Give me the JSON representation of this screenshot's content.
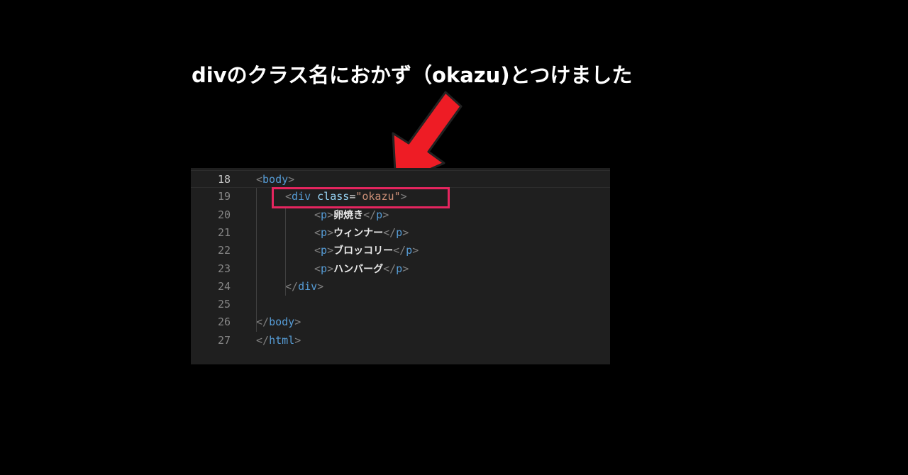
{
  "caption": "divのクラス名におかず（okazu)とつけました",
  "editor": {
    "lines": [
      {
        "num": "18",
        "parts": [
          [
            "br",
            "<"
          ],
          [
            "tag",
            "body"
          ],
          [
            "br",
            ">"
          ]
        ],
        "indent": 0
      },
      {
        "num": "19",
        "parts": [
          [
            "br",
            "<"
          ],
          [
            "tag",
            "div"
          ],
          [
            "txt0",
            " "
          ],
          [
            "attr",
            "class"
          ],
          [
            "txt0",
            "="
          ],
          [
            "str",
            "\"okazu\""
          ],
          [
            "br",
            ">"
          ]
        ],
        "indent": 1
      },
      {
        "num": "20",
        "parts": [
          [
            "br",
            "<"
          ],
          [
            "tag",
            "p"
          ],
          [
            "br",
            ">"
          ],
          [
            "txt",
            "卵焼き"
          ],
          [
            "br",
            "</"
          ],
          [
            "tag",
            "p"
          ],
          [
            "br",
            ">"
          ]
        ],
        "indent": 2
      },
      {
        "num": "21",
        "parts": [
          [
            "br",
            "<"
          ],
          [
            "tag",
            "p"
          ],
          [
            "br",
            ">"
          ],
          [
            "txt",
            "ウィンナー"
          ],
          [
            "br",
            "</"
          ],
          [
            "tag",
            "p"
          ],
          [
            "br",
            ">"
          ]
        ],
        "indent": 2
      },
      {
        "num": "22",
        "parts": [
          [
            "br",
            "<"
          ],
          [
            "tag",
            "p"
          ],
          [
            "br",
            ">"
          ],
          [
            "txt",
            "ブロッコリー"
          ],
          [
            "br",
            "</"
          ],
          [
            "tag",
            "p"
          ],
          [
            "br",
            ">"
          ]
        ],
        "indent": 2
      },
      {
        "num": "23",
        "parts": [
          [
            "br",
            "<"
          ],
          [
            "tag",
            "p"
          ],
          [
            "br",
            ">"
          ],
          [
            "txt",
            "ハンバーグ"
          ],
          [
            "br",
            "</"
          ],
          [
            "tag",
            "p"
          ],
          [
            "br",
            ">"
          ]
        ],
        "indent": 2
      },
      {
        "num": "24",
        "parts": [
          [
            "br",
            "</"
          ],
          [
            "tag",
            "div"
          ],
          [
            "br",
            ">"
          ]
        ],
        "indent": 1
      },
      {
        "num": "25",
        "parts": [],
        "indent": 0
      },
      {
        "num": "26",
        "parts": [
          [
            "br",
            "</"
          ],
          [
            "tag",
            "body"
          ],
          [
            "br",
            ">"
          ]
        ],
        "indent": 0
      },
      {
        "num": "27",
        "parts": [
          [
            "br",
            "</"
          ],
          [
            "tag",
            "html"
          ],
          [
            "br",
            ">"
          ]
        ],
        "indent": 0
      }
    ]
  },
  "colors": {
    "highlight_border": "#e5255f",
    "arrow": "#ee1c25"
  },
  "icons": {
    "pointer": "red-arrow-icon"
  }
}
